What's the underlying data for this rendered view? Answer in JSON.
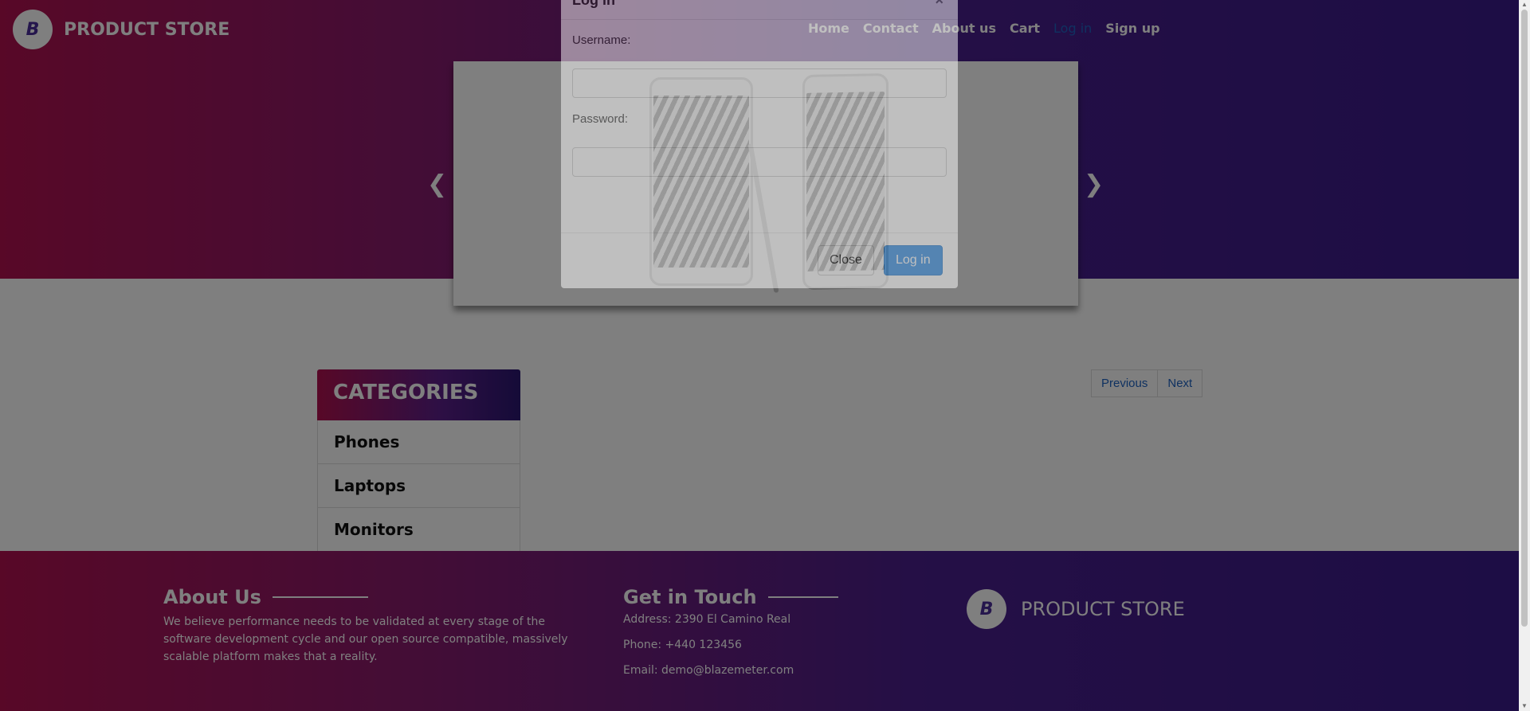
{
  "brand": {
    "name": "PRODUCT STORE",
    "logo_letter": "B"
  },
  "nav": {
    "items": [
      "Home",
      "Contact",
      "About us",
      "Cart",
      "Log in",
      "Sign up"
    ],
    "active": "Log in"
  },
  "carousel": {
    "prev_icon": "chevron-left-icon",
    "next_icon": "chevron-right-icon"
  },
  "categories": {
    "title": "CATEGORIES",
    "items": [
      "Phones",
      "Laptops",
      "Monitors"
    ]
  },
  "pagination": {
    "previous": "Previous",
    "next": "Next"
  },
  "footer": {
    "about_title": "About Us",
    "about_text": "We believe performance needs to be validated at every stage of the software development cycle and our open source compatible, massively scalable platform makes that a reality.",
    "contact_title": "Get in Touch",
    "address": "Address: 2390 El Camino Real",
    "phone": "Phone: +440 123456",
    "email": "Email: demo@blazemeter.com",
    "brand_name": "PRODUCT STORE"
  },
  "modal": {
    "title": "Log in",
    "close_icon": "×",
    "username_label": "Username:",
    "username_value": "",
    "password_label": "Password:",
    "password_value": "",
    "close_button": "Close",
    "login_button": "Log in"
  },
  "colors": {
    "accent": "#2a8ae6",
    "link": "#1e63c2",
    "gradient_start": "#b0114f",
    "gradient_end": "#3a1a8a"
  }
}
